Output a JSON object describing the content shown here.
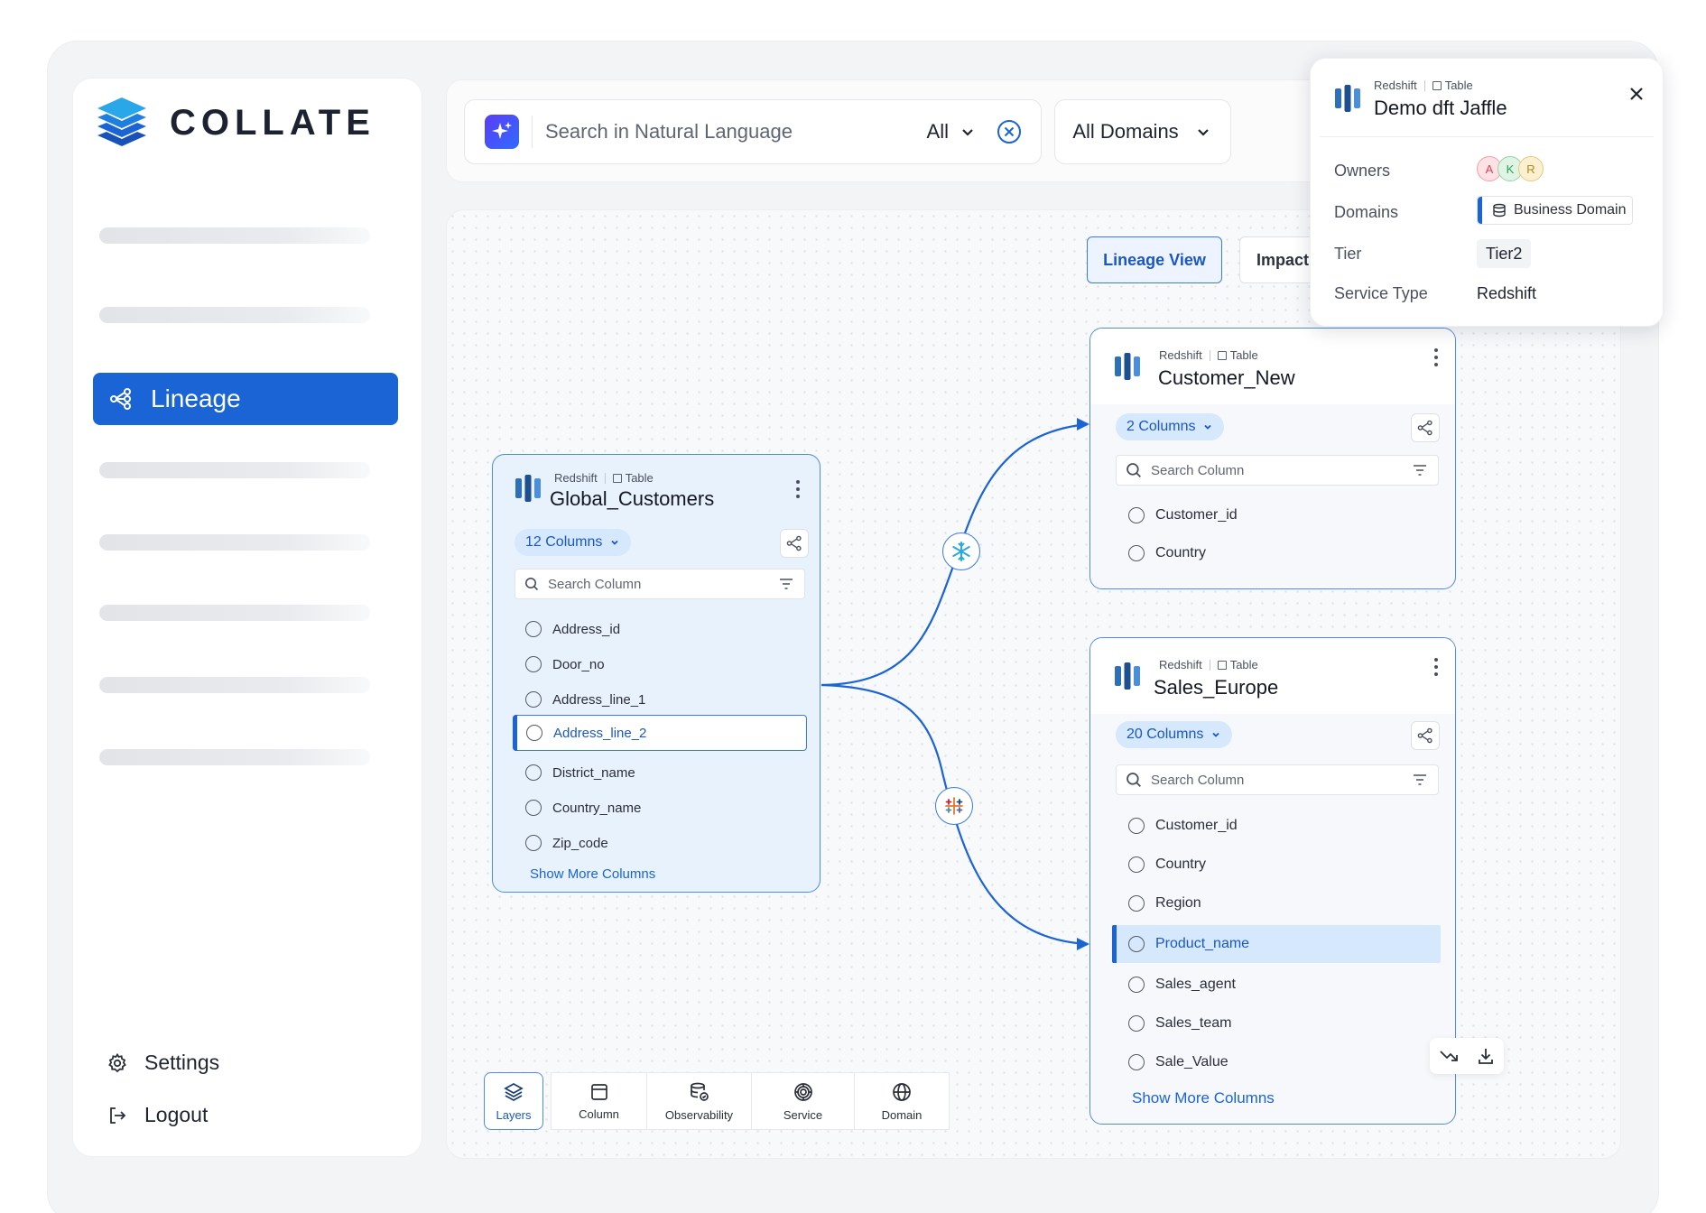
{
  "app": {
    "brand": "COLLATE",
    "accent": "#1a64d6"
  },
  "sidebar": {
    "active_item": {
      "label": "Lineage",
      "icon": "lineage-icon"
    },
    "bottom_items": [
      {
        "label": "Settings",
        "icon": "gear-icon"
      },
      {
        "label": "Logout",
        "icon": "logout-icon"
      }
    ]
  },
  "search": {
    "placeholder": "Search in Natural Language",
    "scope": "All",
    "domains": "All Domains"
  },
  "views": {
    "lineage_view": "Lineage View",
    "impact": "Impact"
  },
  "nodes": {
    "global_customers": {
      "service": "Redshift",
      "type": "Table",
      "title": "Global_Customers",
      "columns_count": "12 Columns",
      "search_placeholder": "Search Column",
      "columns": [
        "Address_id",
        "Door_no",
        "Address_line_1",
        "Address_line_2",
        "District_name",
        "Country_name",
        "Zip_code"
      ],
      "selected_column": "Address_line_2",
      "show_more": "Show More Columns"
    },
    "customer_new": {
      "service": "Redshift",
      "type": "Table",
      "title": "Customer_New",
      "columns_count": "2 Columns",
      "search_placeholder": "Search Column",
      "columns": [
        "Customer_id",
        "Country"
      ]
    },
    "sales_europe": {
      "service": "Redshift",
      "type": "Table",
      "title": "Sales_Europe",
      "columns_count": "20 Columns",
      "search_placeholder": "Search Column",
      "columns": [
        "Customer_id",
        "Country",
        "Region",
        "Product_name",
        "Sales_agent",
        "Sales_team",
        "Sale_Value"
      ],
      "selected_column": "Product_name",
      "show_more": "Show More Columns"
    }
  },
  "edges": [
    {
      "from": "Global_Customers",
      "to": "Customer_New",
      "badge_icon": "snowflake-icon"
    },
    {
      "from": "Global_Customers",
      "to": "Sales_Europe",
      "badge_icon": "tableau-icon"
    }
  ],
  "toolbar": {
    "items": [
      {
        "label": "Layers",
        "icon": "layers-icon",
        "active": true
      },
      {
        "label": "Column",
        "icon": "column-icon"
      },
      {
        "label": "Observability",
        "icon": "observability-icon"
      },
      {
        "label": "Service",
        "icon": "service-icon"
      },
      {
        "label": "Domain",
        "icon": "globe-icon"
      }
    ]
  },
  "details": {
    "service": "Redshift",
    "type": "Table",
    "title": "Demo dft Jaffle",
    "labels": {
      "owners": "Owners",
      "domains": "Domains",
      "tier": "Tier",
      "service_type": "Service Type"
    },
    "owners": [
      "A",
      "K",
      "R"
    ],
    "domain": "Business Domain",
    "tier": "Tier2",
    "service_type": "Redshift"
  }
}
